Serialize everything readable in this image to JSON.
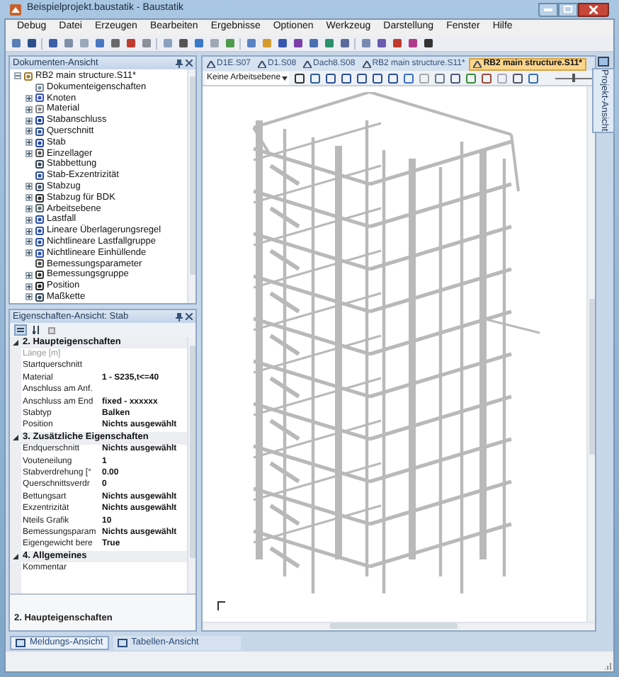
{
  "window": {
    "title": "Beispielprojekt.baustatik - Baustatik"
  },
  "menu": [
    "Debug",
    "Datei",
    "Erzeugen",
    "Bearbeiten",
    "Ergebnisse",
    "Optionen",
    "Werkzeug",
    "Darstellung",
    "Fenster",
    "Hilfe"
  ],
  "document_panel": {
    "title": "Dokumenten-Ansicht",
    "tree": [
      {
        "label": "RB2 main structure.S11*",
        "expanded": true,
        "children": [
          {
            "label": "Dokumenteigenschaften",
            "expandable": false
          },
          {
            "label": "Knoten",
            "expandable": true
          },
          {
            "label": "Material",
            "expandable": true
          },
          {
            "label": "Stabanschluss",
            "expandable": true
          },
          {
            "label": "Querschnitt",
            "expandable": true
          },
          {
            "label": "Stab",
            "expandable": true
          },
          {
            "label": "Einzellager",
            "expandable": true
          },
          {
            "label": "Stabbettung",
            "expandable": false
          },
          {
            "label": "Stab-Exzentrizität",
            "expandable": false
          },
          {
            "label": "Stabzug",
            "expandable": true
          },
          {
            "label": "Stabzug für BDK",
            "expandable": true
          },
          {
            "label": "Arbeitsebene",
            "expandable": true
          },
          {
            "label": "Lastfall",
            "expandable": true
          },
          {
            "label": "Lineare Überlagerungsregel",
            "expandable": true
          },
          {
            "label": "Nichtlineare Lastfallgruppe",
            "expandable": true
          },
          {
            "label": "Nichtlineare Einhüllende",
            "expandable": true
          },
          {
            "label": "Bemessungsparameter",
            "expandable": false
          },
          {
            "label": "Bemessungsgruppe",
            "expandable": true
          },
          {
            "label": "Position",
            "expandable": true
          },
          {
            "label": "Maßkette",
            "expandable": true
          }
        ]
      }
    ]
  },
  "properties_panel": {
    "title": "Eigenschaften-Ansicht: Stab",
    "categories": [
      {
        "label": "2. Haupteigenschaften",
        "expanded": true,
        "rows": [
          {
            "name": "Länge [m]",
            "value": "",
            "disabled": true
          },
          {
            "name": "Startquerschnitt",
            "value": "",
            "disabled": false
          },
          {
            "name": "Material",
            "value": "1 - S235,t<=40",
            "disabled": false
          },
          {
            "name": "Anschluss am Anf.",
            "value": "",
            "disabled": false
          },
          {
            "name": "Anschluss am End",
            "value": "fixed - xxxxxx",
            "disabled": false
          },
          {
            "name": "Stabtyp",
            "value": "Balken",
            "disabled": false
          },
          {
            "name": "Position",
            "value": "Nichts ausgewählt",
            "disabled": false
          }
        ]
      },
      {
        "label": "3. Zusätzliche Eigenschaften",
        "expanded": true,
        "rows": [
          {
            "name": "Endquerschnitt",
            "value": "Nichts ausgewählt",
            "disabled": false
          },
          {
            "name": "Vouteneilung",
            "value": "1",
            "disabled": false
          },
          {
            "name": "Stabverdrehung [°",
            "value": "0.00",
            "disabled": false
          },
          {
            "name": "Querschnittsverdr",
            "value": "0",
            "disabled": false
          },
          {
            "name": "Bettungsart",
            "value": "Nichts ausgewählt",
            "disabled": false
          },
          {
            "name": "Exzentrizität",
            "value": "Nichts ausgewählt",
            "disabled": false
          },
          {
            "name": "Nteils Grafik",
            "value": "10",
            "disabled": false
          },
          {
            "name": "Bemessungsparam",
            "value": "Nichts ausgewählt",
            "disabled": false
          },
          {
            "name": "Eigengewicht bere",
            "value": "True",
            "disabled": false
          }
        ]
      },
      {
        "label": "4. Allgemeines",
        "expanded": true,
        "rows": [
          {
            "name": "Kommentar",
            "value": "",
            "disabled": false
          }
        ]
      }
    ],
    "description": "2. Haupteigenschaften"
  },
  "document_tabs": [
    {
      "label": "D1E.S07",
      "selected": false
    },
    {
      "label": "D1.S08",
      "selected": false
    },
    {
      "label": "Dach8.S08",
      "selected": false
    },
    {
      "label": "RB2 main structure.S11*",
      "selected": false
    },
    {
      "label": "RB2 main structure.S11*",
      "selected": true
    }
  ],
  "workplane_dropdown": "Keine Arbeitsebene",
  "zoom_slider": {
    "level": 0.5
  },
  "side_tab": "Projekt-Ansicht",
  "bottom_tabs": [
    {
      "label": "Meldungs-Ansicht",
      "selected": true
    },
    {
      "label": "Tabellen-Ansicht",
      "selected": false
    }
  ]
}
